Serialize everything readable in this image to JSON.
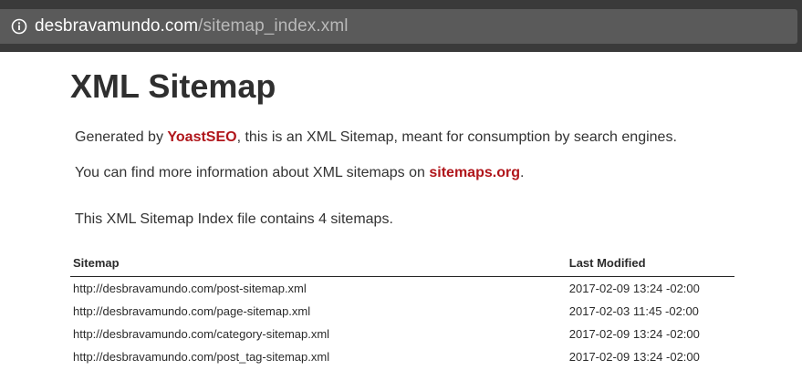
{
  "browser": {
    "url_host": "desbravamundo.com",
    "url_path": "/sitemap_index.xml"
  },
  "page": {
    "title": "XML Sitemap",
    "intro": {
      "prefix": "Generated by ",
      "link_text": "YoastSEO",
      "suffix": ", this is an XML Sitemap, meant for consumption by search engines."
    },
    "info": {
      "prefix": "You can find more information about XML sitemaps on ",
      "link_text": "sitemaps.org",
      "suffix": "."
    },
    "count_text": "This XML Sitemap Index file contains 4 sitemaps."
  },
  "table": {
    "headers": {
      "sitemap": "Sitemap",
      "last_modified": "Last Modified"
    },
    "rows": [
      {
        "url": "http://desbravamundo.com/post-sitemap.xml",
        "last_modified": "2017-02-09 13:24 -02:00"
      },
      {
        "url": "http://desbravamundo.com/page-sitemap.xml",
        "last_modified": "2017-02-03 11:45 -02:00"
      },
      {
        "url": "http://desbravamundo.com/category-sitemap.xml",
        "last_modified": "2017-02-09 13:24 -02:00"
      },
      {
        "url": "http://desbravamundo.com/post_tag-sitemap.xml",
        "last_modified": "2017-02-09 13:24 -02:00"
      }
    ]
  },
  "colors": {
    "link_red": "#b0161b",
    "address_bar_bg": "#3a3a3a",
    "address_field_bg": "#5a5a5a"
  },
  "icons": {
    "address_info": "info-circle-icon"
  }
}
